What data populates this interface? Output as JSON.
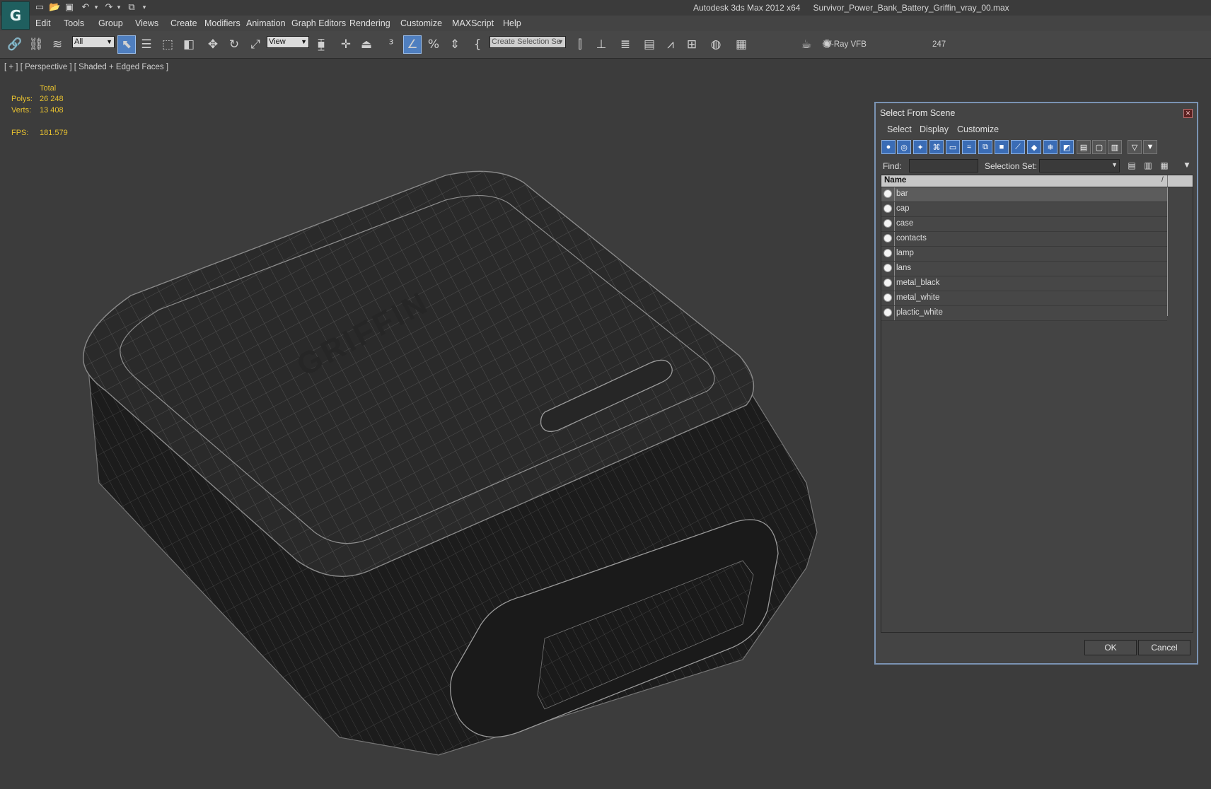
{
  "titlebar": {
    "app_name": "Autodesk 3ds Max  2012 x64",
    "file_name": "Survivor_Power_Bank_Battery_Griffin_vray_00.max",
    "logo_icon": "3ds-max-logo-icon"
  },
  "menus": [
    "Edit",
    "Tools",
    "Group",
    "Views",
    "Create",
    "Modifiers",
    "Animation",
    "Graph Editors",
    "Rendering",
    "Customize",
    "MAXScript",
    "Help"
  ],
  "toolbar": {
    "filter_select": "All",
    "ref_coord_select": "View",
    "named_selection_placeholder": "Create Selection Se",
    "vray_label": "V-Ray VFB",
    "frame_number": "247"
  },
  "viewport": {
    "label": "[ + ] [ Perspective ] [ Shaded + Edged Faces ]",
    "stats": {
      "total_label": "Total",
      "polys_label": "Polys:",
      "polys_value": "26 248",
      "verts_label": "Verts:",
      "verts_value": "13 408",
      "fps_label": "FPS:",
      "fps_value": "181.579"
    },
    "stats_color": "#e6c030"
  },
  "dialog": {
    "title": "Select From Scene",
    "menus": [
      "Select",
      "Display",
      "Customize"
    ],
    "find_label": "Find:",
    "find_value": "",
    "selection_set_label": "Selection Set:",
    "column_name": "Name",
    "column_sort": "/",
    "objects": [
      {
        "name": "bar",
        "selected": true
      },
      {
        "name": "cap",
        "selected": false
      },
      {
        "name": "case",
        "selected": false
      },
      {
        "name": "contacts",
        "selected": false
      },
      {
        "name": "lamp",
        "selected": false
      },
      {
        "name": "lans",
        "selected": false
      },
      {
        "name": "metal_black",
        "selected": false
      },
      {
        "name": "metal_white",
        "selected": false
      },
      {
        "name": "plactic_white",
        "selected": false
      }
    ],
    "ok_label": "OK",
    "cancel_label": "Cancel",
    "accent_color": "#3a6cb5"
  }
}
